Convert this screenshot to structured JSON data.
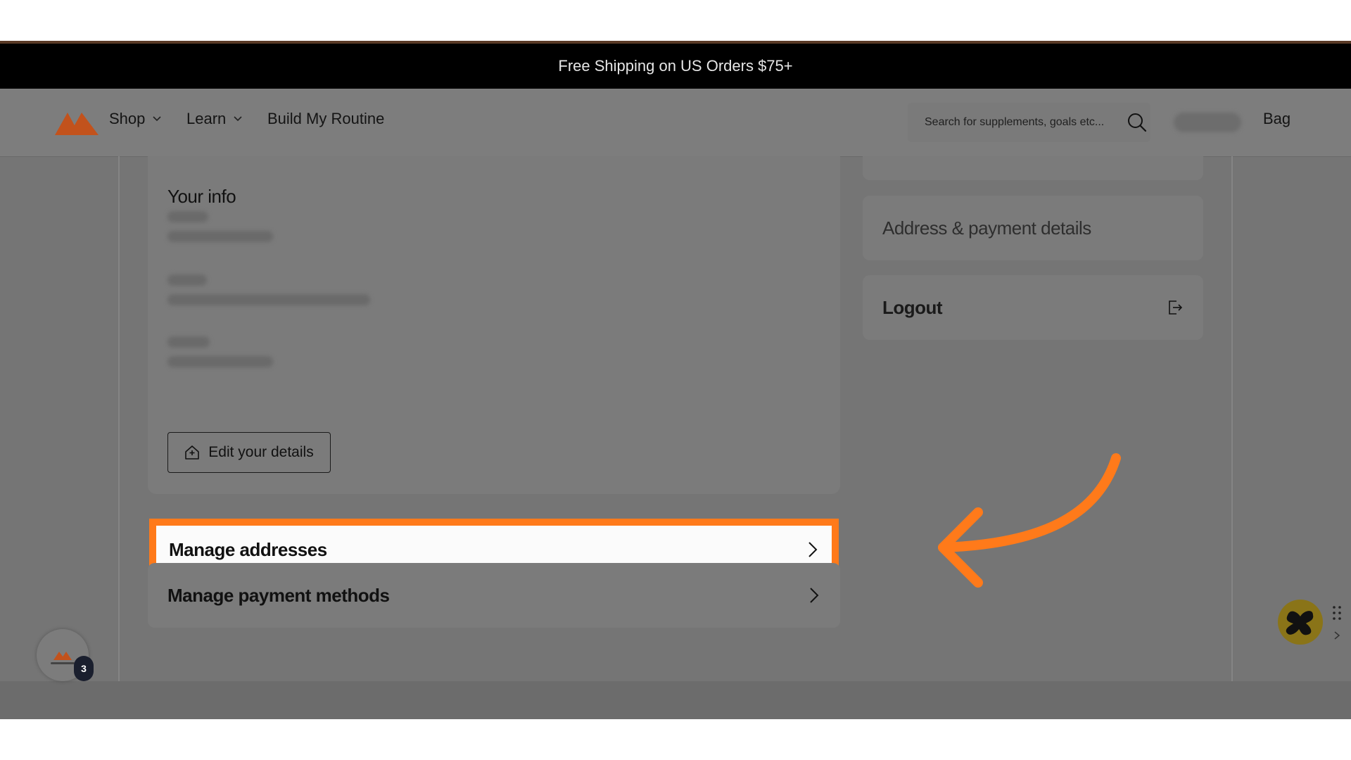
{
  "announcement": "Free Shipping on US Orders $75+",
  "nav": {
    "shop": "Shop",
    "learn": "Learn",
    "build": "Build My Routine",
    "search_placeholder": "Search for supplements, goals etc...",
    "bag": "Bag"
  },
  "info": {
    "title": "Your info",
    "edit_button": "Edit your details"
  },
  "rows": {
    "manage_addresses": "Manage addresses",
    "manage_payments": "Manage payment methods"
  },
  "sidebar": {
    "address_payment": "Address & payment details",
    "logout": "Logout"
  },
  "badge": {
    "count": "3"
  },
  "colors": {
    "accent": "#ff7a1a",
    "brand": "#c2521c"
  }
}
